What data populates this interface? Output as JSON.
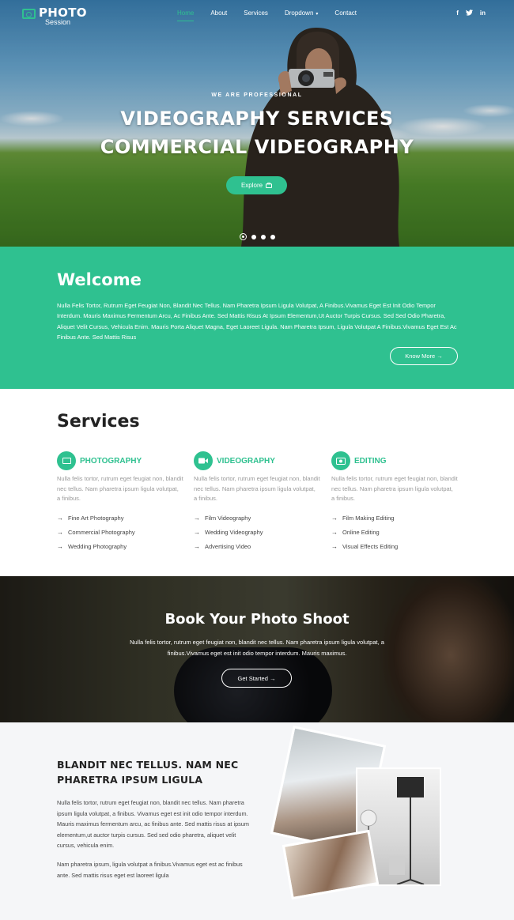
{
  "brand": {
    "name": "PHOTO",
    "tagline": "Session"
  },
  "nav": {
    "items": [
      "Home",
      "About",
      "Services",
      "Dropdown",
      "Contact"
    ],
    "active": "Home",
    "caret": "▾",
    "social": [
      "f",
      "t",
      "in"
    ]
  },
  "hero": {
    "subtitle": "WE ARE PROFESSIONAL",
    "title_line1": "VIDEOGRAPHY SERVICES",
    "title_line2": "COMMERCIAL VIDEOGRAPHY",
    "button": "Explore",
    "slides": 4,
    "active_slide": 1
  },
  "welcome": {
    "title": "Welcome",
    "text": "Nulla Felis Tortor, Rutrum Eget Feugiat Non, Blandit Nec Tellus. Nam Pharetra Ipsum Ligula Volutpat, A Finibus.Vivamus Eget Est Init Odio Tempor Interdum. Mauris Maximus Fermentum Arcu, Ac Finibus Ante. Sed Mattis Risus At Ipsum Elementum,Ut Auctor Turpis Cursus. Sed Sed Odio Pharetra, Aliquet Velit Cursus, Vehicula Enim. Mauris Porta Aliquet Magna, Eget Laoreet Ligula. Nam Pharetra Ipsum, Ligula Volutpat A Finibus.Vivamus Eget Est Ac Finibus Ante. Sed Mattis Risus",
    "button": "Know More →"
  },
  "services": {
    "title": "Services",
    "columns": [
      {
        "title": "PHOTOGRAPHY",
        "desc": "Nulla felis tortor, rutrum eget feugiat non, blandit nec tellus. Nam pharetra ipsum ligula volutpat, a finibus.",
        "items": [
          "Fine Art Photography",
          "Commercial Photography",
          "Wedding Photography"
        ]
      },
      {
        "title": "VIDEOGRAPHY",
        "desc": "Nulla felis tortor, rutrum eget feugiat non, blandit nec tellus. Nam pharetra ipsum ligula volutpat, a finibus.",
        "items": [
          "Film Videography",
          "Wedding Videography",
          "Advertising Video"
        ]
      },
      {
        "title": "EDITING",
        "desc": "Nulla felis tortor, rutrum eget feugiat non, blandit nec tellus. Nam pharetra ipsum ligula volutpat, a finibus.",
        "items": [
          "Film Making Editing",
          "Online Editing",
          "Visual Effects Editing"
        ]
      }
    ]
  },
  "book": {
    "title": "Book Your Photo Shoot",
    "text": "Nulla felis tortor, rutrum eget feugiat non, blandit nec tellus. Nam pharetra ipsum ligula volutpat, a finibus.Vivamus eget est init odio tempor interdum. Mauris maximus.",
    "button": "Get Started →"
  },
  "about": {
    "title": "BLANDIT NEC TELLUS. NAM NEC PHARETRA IPSUM LIGULA",
    "para1": "Nulla felis tortor, rutrum eget feugiat non, blandit nec tellus. Nam pharetra ipsum ligula volutpat, a finibus. Vivamus eget est init odio tempor interdum. Mauris maximus fermentum arcu, ac finibus ante. Sed mattis risus at ipsum elementum,ut auctor turpis cursus. Sed sed odio pharetra, aliquet velit cursus, vehicula enim.",
    "para2": "Nam pharetra ipsum, ligula volutpat a finibus.Vivamus eget est ac finibus ante. Sed mattis risus eget est laoreet ligula"
  },
  "colors": {
    "accent": "#2fc190",
    "text_dark": "#222222"
  }
}
